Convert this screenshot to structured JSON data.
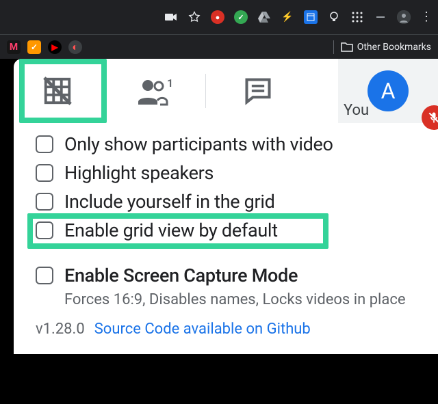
{
  "chrome": {
    "other_bookmarks": "Other Bookmarks"
  },
  "tabs": {
    "you_label": "You",
    "avatar_initial": "A"
  },
  "options": {
    "only_video": "Only show participants with video",
    "highlight": "Highlight speakers",
    "include_self": "Include yourself in the grid",
    "enable_default": "Enable grid view by default",
    "screen_capture": "Enable Screen Capture Mode",
    "screen_capture_sub": "Forces 16:9, Disables names, Locks videos in place"
  },
  "footer": {
    "version": "v1.28.0",
    "source": "Source Code available on Github"
  }
}
